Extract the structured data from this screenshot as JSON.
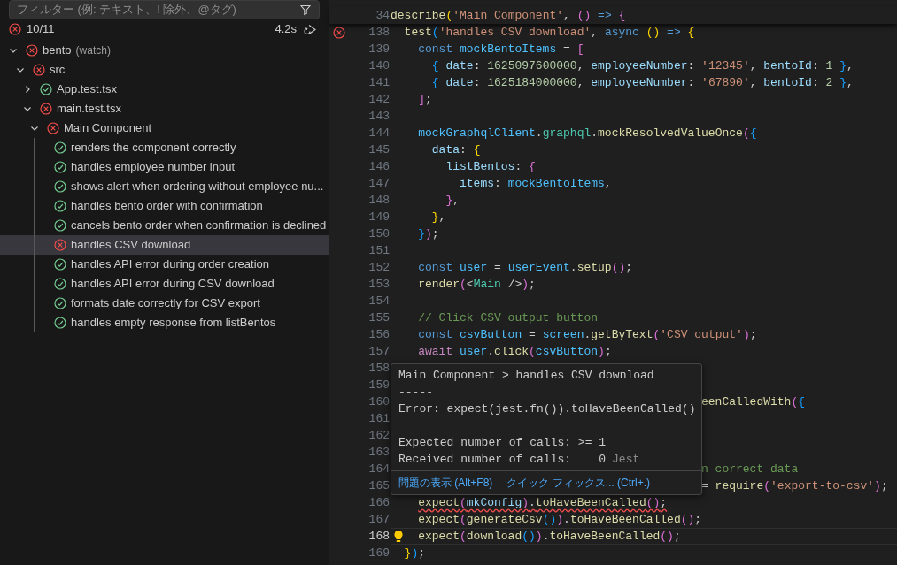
{
  "test_explorer": {
    "filter": {
      "placeholder": "フィルター (例: テキスト、! 除外、@タグ)"
    },
    "summary": {
      "passed": false,
      "count": "10/11",
      "duration": "4.2s"
    },
    "tree": [
      {
        "label": "bento",
        "description": "(watch)",
        "passed": false,
        "expanded": true,
        "children": [
          {
            "label": "src",
            "passed": false,
            "expanded": true,
            "children": [
              {
                "label": "App.test.tsx",
                "passed": true,
                "expanded": false
              },
              {
                "label": "main.test.tsx",
                "passed": false,
                "expanded": true,
                "children": [
                  {
                    "label": "Main Component",
                    "passed": false,
                    "expanded": true,
                    "children": [
                      {
                        "label": "renders the component correctly",
                        "passed": true,
                        "selected": false
                      },
                      {
                        "label": "handles employee number input",
                        "passed": true,
                        "selected": false
                      },
                      {
                        "label": "shows alert when ordering without employee nu...",
                        "passed": true,
                        "selected": false
                      },
                      {
                        "label": "handles bento order with confirmation",
                        "passed": true,
                        "selected": false
                      },
                      {
                        "label": "cancels bento order when confirmation is declined",
                        "passed": true,
                        "selected": false
                      },
                      {
                        "label": "handles CSV download",
                        "passed": false,
                        "selected": true
                      },
                      {
                        "label": "handles API error during order creation",
                        "passed": true,
                        "selected": false
                      },
                      {
                        "label": "handles API error during CSV download",
                        "passed": true,
                        "selected": false
                      },
                      {
                        "label": "formats date correctly for CSV export",
                        "passed": true,
                        "selected": false
                      },
                      {
                        "label": "handles empty response from listBentos",
                        "passed": true,
                        "selected": false
                      }
                    ]
                  }
                ]
              }
            ]
          }
        ]
      }
    ]
  },
  "editor": {
    "sticky_line": {
      "number": "34",
      "tokens": [
        {
          "kind": "fn",
          "text": "describe"
        },
        {
          "kind": "b1",
          "text": "("
        },
        {
          "kind": "str",
          "text": "'Main Component'"
        },
        {
          "kind": "p",
          "text": ", "
        },
        {
          "kind": "b2",
          "text": "()"
        },
        {
          "kind": "kw",
          "text": " =>"
        },
        {
          "kind": "b2",
          "text": " {"
        }
      ]
    },
    "lines": [
      {
        "number": "138",
        "kind": "failed-test",
        "tokens": [
          {
            "kind": "fn",
            "text": "  test"
          },
          {
            "kind": "b3",
            "text": "("
          },
          {
            "kind": "str",
            "text": "'handles CSV download'"
          },
          {
            "kind": "p",
            "text": ", "
          },
          {
            "kind": "kw",
            "text": "async"
          },
          {
            "kind": "b1",
            "text": " ()"
          },
          {
            "kind": "kw",
            "text": " =>"
          },
          {
            "kind": "b1",
            "text": " {"
          }
        ]
      },
      {
        "number": "139",
        "kind": "code",
        "tokens": [
          {
            "kind": "kw",
            "text": "    const"
          },
          {
            "kind": "cv",
            "text": " mockBentoItems"
          },
          {
            "kind": "p",
            "text": " = "
          },
          {
            "kind": "b2",
            "text": "["
          }
        ]
      },
      {
        "number": "140",
        "kind": "code",
        "tokens": [
          {
            "kind": "b3",
            "text": "      {"
          },
          {
            "kind": "v",
            "text": " date"
          },
          {
            "kind": "p",
            "text": ": "
          },
          {
            "kind": "num",
            "text": "1625097600000"
          },
          {
            "kind": "p",
            "text": ", "
          },
          {
            "kind": "v",
            "text": "employeeNumber"
          },
          {
            "kind": "p",
            "text": ": "
          },
          {
            "kind": "str",
            "text": "'12345'"
          },
          {
            "kind": "p",
            "text": ", "
          },
          {
            "kind": "v",
            "text": "bentoId"
          },
          {
            "kind": "p",
            "text": ": "
          },
          {
            "kind": "num",
            "text": "1"
          },
          {
            "kind": "b3",
            "text": " }"
          },
          {
            "kind": "p",
            "text": ","
          }
        ]
      },
      {
        "number": "141",
        "kind": "code",
        "tokens": [
          {
            "kind": "b3",
            "text": "      {"
          },
          {
            "kind": "v",
            "text": " date"
          },
          {
            "kind": "p",
            "text": ": "
          },
          {
            "kind": "num",
            "text": "1625184000000"
          },
          {
            "kind": "p",
            "text": ", "
          },
          {
            "kind": "v",
            "text": "employeeNumber"
          },
          {
            "kind": "p",
            "text": ": "
          },
          {
            "kind": "str",
            "text": "'67890'"
          },
          {
            "kind": "p",
            "text": ", "
          },
          {
            "kind": "v",
            "text": "bentoId"
          },
          {
            "kind": "p",
            "text": ": "
          },
          {
            "kind": "num",
            "text": "2"
          },
          {
            "kind": "b3",
            "text": " }"
          },
          {
            "kind": "p",
            "text": ","
          }
        ]
      },
      {
        "number": "142",
        "kind": "code",
        "tokens": [
          {
            "kind": "b2",
            "text": "    ]"
          },
          {
            "kind": "p",
            "text": ";"
          }
        ]
      },
      {
        "number": "143",
        "kind": "code"
      },
      {
        "number": "144",
        "kind": "code",
        "tokens": [
          {
            "kind": "cv",
            "text": "    mockGraphqlClient"
          },
          {
            "kind": "p",
            "text": "."
          },
          {
            "kind": "ty",
            "text": "graphql"
          },
          {
            "kind": "p",
            "text": "."
          },
          {
            "kind": "fn",
            "text": "mockResolvedValueOnce"
          },
          {
            "kind": "b2",
            "text": "("
          },
          {
            "kind": "b3",
            "text": "{"
          }
        ]
      },
      {
        "number": "145",
        "kind": "code",
        "tokens": [
          {
            "kind": "v",
            "text": "      data"
          },
          {
            "kind": "p",
            "text": ": "
          },
          {
            "kind": "b1",
            "text": "{"
          }
        ]
      },
      {
        "number": "146",
        "kind": "code",
        "tokens": [
          {
            "kind": "v",
            "text": "        listBentos"
          },
          {
            "kind": "p",
            "text": ": "
          },
          {
            "kind": "b2",
            "text": "{"
          }
        ]
      },
      {
        "number": "147",
        "kind": "code",
        "tokens": [
          {
            "kind": "v",
            "text": "          items"
          },
          {
            "kind": "p",
            "text": ": "
          },
          {
            "kind": "cv",
            "text": "mockBentoItems"
          },
          {
            "kind": "p",
            "text": ","
          }
        ]
      },
      {
        "number": "148",
        "kind": "code",
        "tokens": [
          {
            "kind": "b2",
            "text": "        }"
          },
          {
            "kind": "p",
            "text": ","
          }
        ]
      },
      {
        "number": "149",
        "kind": "code",
        "tokens": [
          {
            "kind": "b1",
            "text": "      }"
          },
          {
            "kind": "p",
            "text": ","
          }
        ]
      },
      {
        "number": "150",
        "kind": "code",
        "tokens": [
          {
            "kind": "b3",
            "text": "    }"
          },
          {
            "kind": "b2",
            "text": ")"
          },
          {
            "kind": "p",
            "text": ";"
          }
        ]
      },
      {
        "number": "151",
        "kind": "code"
      },
      {
        "number": "152",
        "kind": "code",
        "tokens": [
          {
            "kind": "kw",
            "text": "    const"
          },
          {
            "kind": "cv",
            "text": " user"
          },
          {
            "kind": "p",
            "text": " = "
          },
          {
            "kind": "cv",
            "text": "userEvent"
          },
          {
            "kind": "p",
            "text": "."
          },
          {
            "kind": "fn",
            "text": "setup"
          },
          {
            "kind": "b2",
            "text": "()"
          },
          {
            "kind": "p",
            "text": ";"
          }
        ]
      },
      {
        "number": "153",
        "kind": "code",
        "tokens": [
          {
            "kind": "fn",
            "text": "    render"
          },
          {
            "kind": "b2",
            "text": "("
          },
          {
            "kind": "p",
            "text": "<"
          },
          {
            "kind": "ty",
            "text": "Main"
          },
          {
            "kind": "p",
            "text": " />"
          },
          {
            "kind": "b2",
            "text": ")"
          },
          {
            "kind": "p",
            "text": ";"
          }
        ]
      },
      {
        "number": "154",
        "kind": "code"
      },
      {
        "number": "155",
        "kind": "code",
        "tokens": [
          {
            "kind": "cm",
            "text": "    // Click CSV output button"
          }
        ]
      },
      {
        "number": "156",
        "kind": "code",
        "tokens": [
          {
            "kind": "kw",
            "text": "    const"
          },
          {
            "kind": "cv",
            "text": " csvButton"
          },
          {
            "kind": "p",
            "text": " = "
          },
          {
            "kind": "cv",
            "text": "screen"
          },
          {
            "kind": "p",
            "text": "."
          },
          {
            "kind": "fn",
            "text": "getByText"
          },
          {
            "kind": "b2",
            "text": "("
          },
          {
            "kind": "str",
            "text": "'CSV output'"
          },
          {
            "kind": "b2",
            "text": ")"
          },
          {
            "kind": "p",
            "text": ";"
          }
        ]
      },
      {
        "number": "157",
        "kind": "code",
        "tokens": [
          {
            "kind": "ctl",
            "text": "    await"
          },
          {
            "kind": "cv",
            "text": " user"
          },
          {
            "kind": "p",
            "text": "."
          },
          {
            "kind": "fn",
            "text": "click"
          },
          {
            "kind": "b2",
            "text": "("
          },
          {
            "kind": "cv",
            "text": "csvButton"
          },
          {
            "kind": "b2",
            "text": ")"
          },
          {
            "kind": "p",
            "text": ";"
          }
        ]
      },
      {
        "number": "158",
        "kind": "covered"
      },
      {
        "number": "159",
        "kind": "covered"
      },
      {
        "number": "160",
        "kind": "covered",
        "tokens": [
          {
            "kind": "fn",
            "text": "eenCalledWith"
          },
          {
            "kind": "b2",
            "text": "("
          },
          {
            "kind": "b3",
            "text": "{"
          }
        ]
      },
      {
        "number": "161",
        "kind": "covered"
      },
      {
        "number": "162",
        "kind": "covered"
      },
      {
        "number": "163",
        "kind": "covered"
      },
      {
        "number": "164",
        "kind": "covered",
        "tokens": [
          {
            "kind": "cm",
            "text": "n correct data"
          }
        ]
      },
      {
        "number": "165",
        "kind": "covered",
        "tokens": [
          {
            "kind": "p",
            "text": " = "
          },
          {
            "kind": "fn",
            "text": "require"
          },
          {
            "kind": "b2",
            "text": "("
          },
          {
            "kind": "str",
            "text": "'export-to-csv'"
          },
          {
            "kind": "b2",
            "text": ")"
          },
          {
            "kind": "p",
            "text": ";"
          }
        ]
      },
      {
        "number": "166",
        "kind": "error",
        "tokens": [
          {
            "kind": "fn",
            "text": "    expect"
          },
          {
            "kind": "b2",
            "text": "("
          },
          {
            "kind": "v",
            "text": "mkConfig"
          },
          {
            "kind": "b2",
            "text": ")"
          },
          {
            "kind": "p",
            "text": "."
          },
          {
            "kind": "fn",
            "text": "toHaveBeenCalled"
          },
          {
            "kind": "b2",
            "text": "()"
          },
          {
            "kind": "p",
            "text": ";"
          }
        ]
      },
      {
        "number": "167",
        "kind": "code",
        "tokens": [
          {
            "kind": "fn",
            "text": "    expect"
          },
          {
            "kind": "b2",
            "text": "("
          },
          {
            "kind": "fn",
            "text": "generateCsv"
          },
          {
            "kind": "b3",
            "text": "()"
          },
          {
            "kind": "b2",
            "text": ")"
          },
          {
            "kind": "p",
            "text": "."
          },
          {
            "kind": "fn",
            "text": "toHaveBeenCalled"
          },
          {
            "kind": "b2",
            "text": "()"
          },
          {
            "kind": "p",
            "text": ";"
          }
        ]
      },
      {
        "number": "168",
        "kind": "cursor",
        "tokens": [
          {
            "kind": "fn",
            "text": "    expect"
          },
          {
            "kind": "b2",
            "text": "("
          },
          {
            "kind": "fn",
            "text": "download"
          },
          {
            "kind": "b3",
            "text": "()"
          },
          {
            "kind": "b2",
            "text": ")"
          },
          {
            "kind": "p",
            "text": "."
          },
          {
            "kind": "fn",
            "text": "toHaveBeenCalled"
          },
          {
            "kind": "b2",
            "text": "()"
          },
          {
            "kind": "p",
            "text": ";"
          }
        ]
      },
      {
        "number": "169",
        "kind": "code",
        "tokens": [
          {
            "kind": "b1",
            "text": "  }"
          },
          {
            "kind": "b3",
            "text": ")"
          },
          {
            "kind": "p",
            "text": ";"
          }
        ]
      }
    ],
    "hover": {
      "message": "Main Component > handles CSV download\n-----\nError: expect(jest.fn()).toHaveBeenCalled()\n\nExpected number of calls: >= 1",
      "detail": "Received number of calls:    0",
      "source": "Jest",
      "actions": [
        "問題の表示 (Alt+F8)",
        "クイック フィックス... (Ctrl+.)"
      ]
    }
  }
}
